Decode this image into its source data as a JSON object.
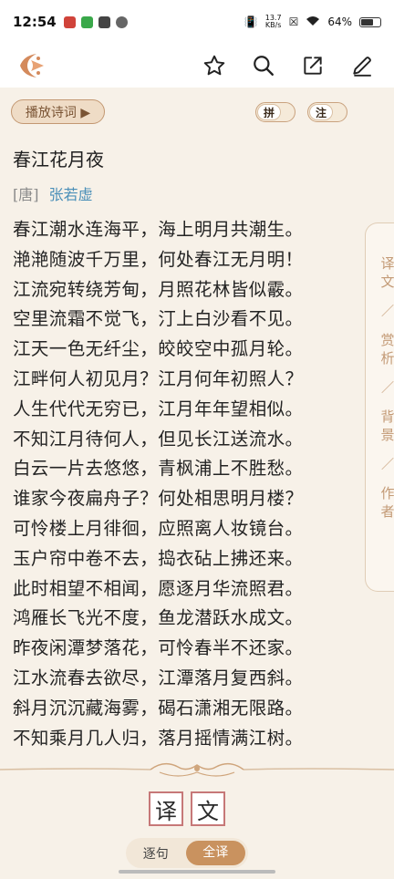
{
  "status_bar": {
    "time": "12:54",
    "net_speed_value": "13.7",
    "net_speed_unit": "KB/s",
    "battery": "64%"
  },
  "header": {
    "logo_icon": "app-logo-icon",
    "actions": [
      "star-icon",
      "search-icon",
      "share-icon",
      "edit-icon"
    ]
  },
  "controls": {
    "play_label": "播放诗词 ▶",
    "pinyin_label": "拼",
    "annotation_label": "注"
  },
  "poem": {
    "title": "春江花月夜",
    "dynasty": "[唐]",
    "author": "张若虚",
    "lines": [
      "春江潮水连海平，海上明月共潮生。",
      "滟滟随波千万里，何处春江无月明！",
      "江流宛转绕芳甸，月照花林皆似霰。",
      "空里流霜不觉飞，汀上白沙看不见。",
      "江天一色无纤尘，皎皎空中孤月轮。",
      "江畔何人初见月？江月何年初照人？",
      "人生代代无穷已，江月年年望相似。",
      "不知江月待何人，但见长江送流水。",
      "白云一片去悠悠，青枫浦上不胜愁。",
      "谁家今夜扁舟子？何处相思明月楼？",
      "可怜楼上月徘徊，应照离人妆镜台。",
      "玉户帘中卷不去，捣衣砧上拂还来。",
      "此时相望不相闻，愿逐月华流照君。",
      "鸿雁长飞光不度，鱼龙潜跃水成文。",
      "昨夜闲潭梦落花，可怜春半不还家。",
      "江水流春去欲尽，江潭落月复西斜。",
      "斜月沉沉藏海雾，碣石潇湘无限路。",
      "不知乘月几人归，落月摇情满江树。"
    ]
  },
  "side_tabs": [
    {
      "c1": "译",
      "c2": "文"
    },
    {
      "c1": "赏",
      "c2": "析"
    },
    {
      "c1": "背",
      "c2": "景"
    },
    {
      "c1": "作",
      "c2": "者"
    }
  ],
  "translation": {
    "title_chars": [
      "译",
      "文"
    ],
    "mode_line": "逐句",
    "mode_full": "全译"
  },
  "colors": {
    "accent": "#c9925f",
    "author_link": "#4a8fb8",
    "background": "#f7f1e8"
  }
}
